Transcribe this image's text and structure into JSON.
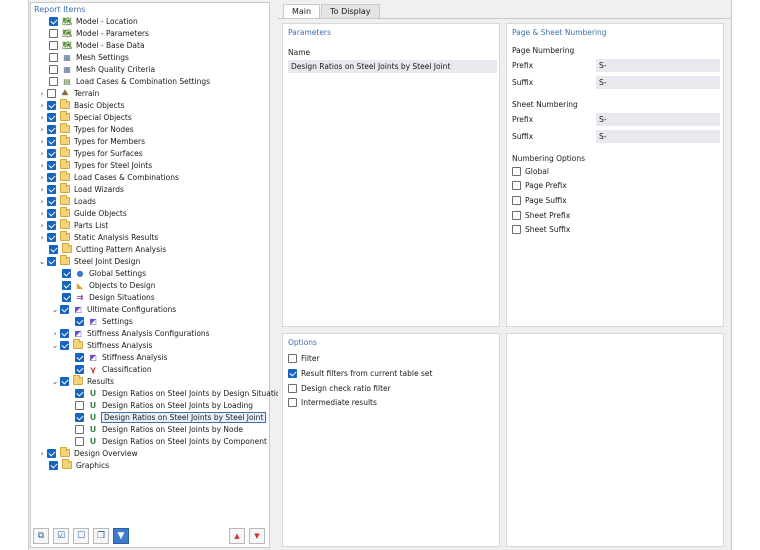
{
  "left_pane": {
    "header": "Report Items",
    "tree": [
      {
        "label": "Model - Location",
        "checked": true,
        "icon": "model-location-icon"
      },
      {
        "label": "Model - Parameters",
        "checked": false,
        "icon": "model-parameters-icon"
      },
      {
        "label": "Model - Base Data",
        "checked": false,
        "icon": "model-base-data-icon"
      },
      {
        "label": "Mesh Settings",
        "checked": false,
        "icon": "mesh-settings-icon"
      },
      {
        "label": "Mesh Quality Criteria",
        "checked": false,
        "icon": "mesh-quality-icon"
      },
      {
        "label": "Load Cases & Combination Settings",
        "checked": false,
        "icon": "load-cases-settings-icon"
      },
      {
        "label": "Terrain",
        "checked": false,
        "icon": "terrain-icon",
        "expander": "›"
      },
      {
        "label": "Basic Objects",
        "checked": true,
        "icon": "folder-icon",
        "expander": "›"
      },
      {
        "label": "Special Objects",
        "checked": true,
        "icon": "folder-icon",
        "expander": "›"
      },
      {
        "label": "Types for Nodes",
        "checked": true,
        "icon": "folder-icon",
        "expander": "›"
      },
      {
        "label": "Types for Members",
        "checked": true,
        "icon": "folder-icon",
        "expander": "›"
      },
      {
        "label": "Types for Surfaces",
        "checked": true,
        "icon": "folder-icon",
        "expander": "›"
      },
      {
        "label": "Types for Steel Joints",
        "checked": true,
        "icon": "folder-icon",
        "expander": "›"
      },
      {
        "label": "Load Cases & Combinations",
        "checked": true,
        "icon": "folder-icon",
        "expander": "›"
      },
      {
        "label": "Load Wizards",
        "checked": true,
        "icon": "folder-icon",
        "expander": "›"
      },
      {
        "label": "Loads",
        "checked": true,
        "icon": "folder-icon",
        "expander": "›"
      },
      {
        "label": "Guide Objects",
        "checked": true,
        "icon": "folder-icon",
        "expander": "›"
      },
      {
        "label": "Parts List",
        "checked": true,
        "icon": "folder-icon",
        "expander": "›"
      },
      {
        "label": "Static Analysis Results",
        "checked": true,
        "icon": "folder-icon",
        "expander": "›"
      },
      {
        "label": "Cutting Pattern Analysis",
        "checked": true,
        "icon": "folder-icon"
      },
      {
        "label": "Steel Joint Design",
        "checked": true,
        "icon": "folder-icon",
        "expander": "⌄"
      },
      {
        "label": "Global Settings",
        "checked": true,
        "icon": "globe-icon"
      },
      {
        "label": "Objects to Design",
        "checked": true,
        "icon": "objects-to-design-icon"
      },
      {
        "label": "Design Situations",
        "checked": true,
        "icon": "design-situations-icon"
      },
      {
        "label": "Ultimate Configurations",
        "checked": true,
        "icon": "configuration-icon",
        "expander": "⌄"
      },
      {
        "label": "Settings",
        "checked": true,
        "icon": "configuration-icon"
      },
      {
        "label": "Stiffness Analysis Configurations",
        "checked": true,
        "icon": "configuration-icon",
        "expander": "›"
      },
      {
        "label": "Stiffness Analysis",
        "checked": true,
        "icon": "folder-icon",
        "expander": "⌄"
      },
      {
        "label": "Stiffness Analysis",
        "checked": true,
        "icon": "configuration-icon"
      },
      {
        "label": "Classification",
        "checked": true,
        "icon": "classification-icon"
      },
      {
        "label": "Results",
        "checked": true,
        "icon": "folder-icon",
        "expander": "⌄"
      },
      {
        "label": "Design Ratios on Steel Joints by Design Situation",
        "checked": true,
        "icon": "result-table-icon"
      },
      {
        "label": "Design Ratios on Steel Joints by Loading",
        "checked": false,
        "icon": "result-table-icon"
      },
      {
        "label": "Design Ratios on Steel Joints by Steel Joint",
        "checked": true,
        "icon": "result-table-icon",
        "selected": true
      },
      {
        "label": "Design Ratios on Steel Joints by Node",
        "checked": false,
        "icon": "result-table-icon"
      },
      {
        "label": "Design Ratios on Steel Joints by Component",
        "checked": false,
        "icon": "result-table-icon"
      },
      {
        "label": "Design Overview",
        "checked": true,
        "icon": "folder-icon",
        "expander": "›"
      },
      {
        "label": "Graphics",
        "checked": true,
        "icon": "folder-icon"
      }
    ]
  },
  "tabs": [
    {
      "label": "Main",
      "active": true
    },
    {
      "label": "To Display",
      "active": false
    }
  ],
  "parameters": {
    "title": "Parameters",
    "name_label": "Name",
    "name_value": "Design Ratios on Steel Joints by Steel Joint"
  },
  "numbering": {
    "title": "Page & Sheet Numbering",
    "page_heading": "Page Numbering",
    "page_prefix_label": "Prefix",
    "page_prefix_value": "S-",
    "page_suffix_label": "Suffix",
    "page_suffix_value": "S-",
    "sheet_heading": "Sheet Numbering",
    "sheet_prefix_label": "Prefix",
    "sheet_prefix_value": "S-",
    "sheet_suffix_label": "Suffix",
    "sheet_suffix_value": "S-",
    "options_heading": "Numbering Options",
    "options": [
      {
        "label": "Global",
        "checked": false
      },
      {
        "label": "Page Prefix",
        "checked": false
      },
      {
        "label": "Page Suffix",
        "checked": false
      },
      {
        "label": "Sheet Prefix",
        "checked": false
      },
      {
        "label": "Sheet Suffix",
        "checked": false
      }
    ]
  },
  "options": {
    "title": "Options",
    "items": [
      {
        "label": "Filter",
        "checked": false
      },
      {
        "label": "Result filters from current table set",
        "checked": true
      },
      {
        "label": "Design check ratio filter",
        "checked": false
      },
      {
        "label": "Intermediate results",
        "checked": false
      }
    ]
  },
  "colors": {
    "accent": "#3d6fb0",
    "checkbox_on": "#1565c0",
    "folder": "#f3d47a",
    "arrow": "#d0322e"
  }
}
